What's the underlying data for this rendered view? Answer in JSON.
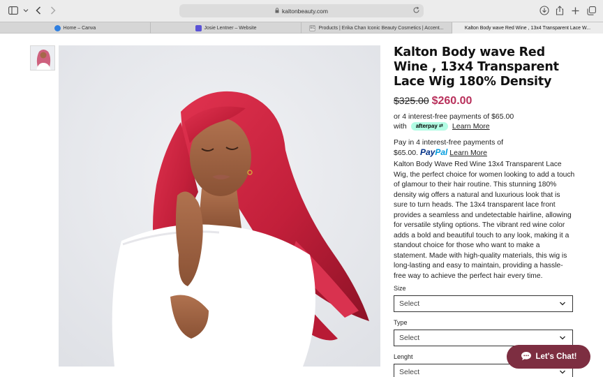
{
  "browser": {
    "url": "kaltonbeauty.com",
    "tabs": [
      {
        "label": "Home – Canva",
        "favicon_color": "#2f7fe0"
      },
      {
        "label": "Josie Lentner – Website",
        "favicon_color": "#5a52d6"
      },
      {
        "label": "Products | Erika Chan Iconic Beauty Cosmetics | Accent...",
        "favicon_color": "#e0e0e0",
        "favicon_text": "EC"
      },
      {
        "label": "Kalton Body wave Red Wine , 13x4 Transparent Lace W...",
        "favicon_color": ""
      }
    ]
  },
  "product": {
    "title": "Kalton Body wave Red Wine , 13x4 Transparent Lace Wig 180% Density",
    "old_price": "$325.00",
    "price": "$260.00",
    "price_color": "#b8305b",
    "afterpay_line1": "or 4 interest-free payments of $65.00",
    "afterpay_with": "with",
    "afterpay_badge": "afterpay",
    "afterpay_learn": "Learn More",
    "paypal_line1": "Pay in 4 interest-free payments of",
    "paypal_amount": "$65.00.",
    "paypal_logo_pay": "Pay",
    "paypal_logo_pal": "Pal",
    "paypal_learn": "Learn More",
    "description": "Kalton Body Wave Red Wine 13x4 Transparent Lace Wig, the perfect choice for women looking to add a touch of glamour to their hair routine. This stunning 180% density wig offers a natural and luxurious look that is sure to turn heads. The 13x4 transparent lace front provides a seamless and undetectable hairline, allowing for versatile styling options. The vibrant red wine color adds a bold and beautiful touch to any look, making it a standout choice for those who want to make a statement. Made with high-quality materials, this wig is long-lasting and easy to maintain, providing a hassle-free way to achieve the perfect hair every time."
  },
  "options": {
    "size_label": "Size",
    "size_value": "Select",
    "type_label": "Type",
    "type_value": "Select",
    "length_label": "Lenght",
    "length_value": "Select"
  },
  "chat": {
    "label": "Let's Chat!",
    "color": "#7d2e41"
  }
}
